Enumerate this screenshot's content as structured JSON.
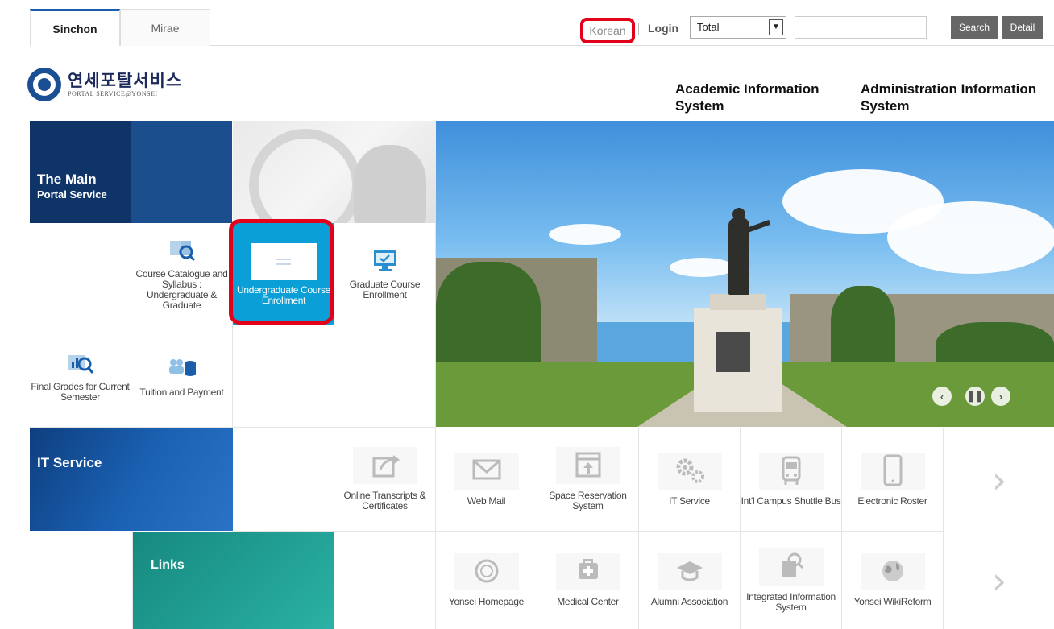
{
  "campus_tabs": [
    {
      "label": "Sinchon",
      "active": true
    },
    {
      "label": "Mirae",
      "active": false
    }
  ],
  "top_links": {
    "language": "Korean",
    "login": "Login"
  },
  "search": {
    "scope_selected": "Total",
    "query": "",
    "search_label": "Search",
    "detail_label": "Detail"
  },
  "logo": {
    "korean": "연세포탈서비스",
    "english": "PORTAL SERVICE@YONSEI"
  },
  "system_links": {
    "academic": "Academic Information System",
    "admin": "Administration Information System"
  },
  "main_portal": {
    "title": "The Main",
    "subtitle": "Portal Service",
    "tiles": {
      "course_catalogue": "Course Catalogue and Syllabus : Undergraduate & Graduate",
      "undergraduate_enrollment": "Undergraduate Course Enrollment",
      "graduate_enrollment": "Graduate Course Enrollment",
      "final_grades": "Final Grades for Current Semester",
      "tuition": "Tuition and Payment"
    }
  },
  "it_service": {
    "title": "IT Service",
    "tiles": {
      "transcripts": "Online Transcripts & Certificates",
      "webmail": "Web Mail",
      "space_reservation": "Space Reservation System",
      "it_service": "IT Service",
      "shuttle": "Int'l Campus Shuttle Bus",
      "roster": "Electronic Roster"
    }
  },
  "links": {
    "title": "Links",
    "tiles": {
      "homepage": "Yonsei Homepage",
      "medical": "Medical Center",
      "alumni": "Alumni Association",
      "integrated": "Integrated Information System",
      "wikireform": "Yonsei WikiReform"
    }
  },
  "icons": {
    "next": "chevron-right-icon",
    "hero_prev": "chevron-left-icon",
    "hero_pause": "pause-icon",
    "hero_next": "chevron-right-icon"
  },
  "colors": {
    "accent_blue": "#1a5eab",
    "enroll_tile": "#0a9fd6",
    "highlight": "#e3001b",
    "links_teal": "#1fa39b"
  }
}
